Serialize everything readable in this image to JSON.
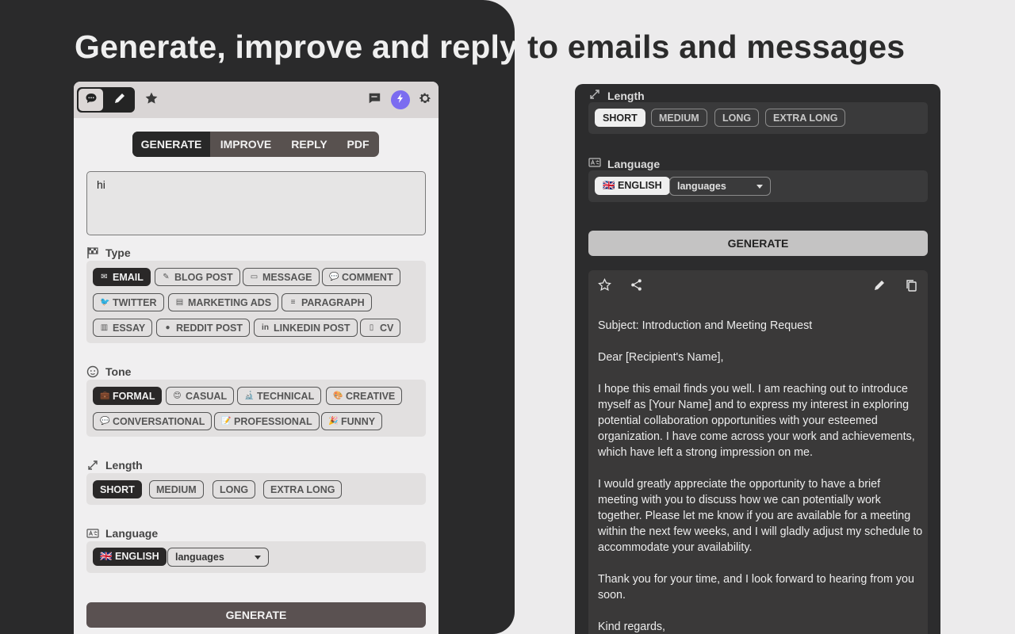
{
  "headline": {
    "part_a": "Generate, improve and reply",
    "part_b": "to emails and messages"
  },
  "colors": {
    "dark_bg": "#2a2a2b",
    "panel_light": "#f0eff0",
    "accent_purple": "#7b6cf0",
    "active_chip": "#2a2828"
  },
  "left_panel": {
    "toolbar": {
      "icons": [
        "chat-bubble-icon",
        "pencil-icon",
        "star-icon",
        "feedback-icon",
        "lightning-icon",
        "gear-icon"
      ]
    },
    "tabs": [
      {
        "label": "GENERATE",
        "active": true
      },
      {
        "label": "IMPROVE",
        "active": false
      },
      {
        "label": "REPLY",
        "active": false
      },
      {
        "label": "PDF",
        "active": false
      }
    ],
    "prompt_value": "hi",
    "type": {
      "label": "Type",
      "options": [
        {
          "label": "EMAIL",
          "icon": "✉",
          "active": true
        },
        {
          "label": "BLOG POST",
          "icon": "✎",
          "active": false
        },
        {
          "label": "MESSAGE",
          "icon": "▭",
          "active": false
        },
        {
          "label": "COMMENT",
          "icon": "💬",
          "active": false
        },
        {
          "label": "TWITTER",
          "icon": "🐦",
          "active": false
        },
        {
          "label": "MARKETING ADS",
          "icon": "▤",
          "active": false
        },
        {
          "label": "PARAGRAPH",
          "icon": "≡",
          "active": false
        },
        {
          "label": "ESSAY",
          "icon": "▥",
          "active": false
        },
        {
          "label": "REDDIT POST",
          "icon": "●",
          "active": false
        },
        {
          "label": "LINKEDIN POST",
          "icon": "in",
          "active": false
        },
        {
          "label": "CV",
          "icon": "▯",
          "active": false
        }
      ]
    },
    "tone": {
      "label": "Tone",
      "options": [
        {
          "label": "FORMAL",
          "icon": "💼",
          "active": true
        },
        {
          "label": "CASUAL",
          "icon": "😊",
          "active": false
        },
        {
          "label": "TECHNICAL",
          "icon": "🔬",
          "active": false
        },
        {
          "label": "CREATIVE",
          "icon": "🎨",
          "active": false
        },
        {
          "label": "CONVERSATIONAL",
          "icon": "💬",
          "active": false
        },
        {
          "label": "PROFESSIONAL",
          "icon": "📝",
          "active": false
        },
        {
          "label": "FUNNY",
          "icon": "🎉",
          "active": false
        }
      ]
    },
    "length": {
      "label": "Length",
      "options": [
        {
          "label": "SHORT",
          "active": true
        },
        {
          "label": "MEDIUM",
          "active": false
        },
        {
          "label": "LONG",
          "active": false
        },
        {
          "label": "EXTRA LONG",
          "active": false
        }
      ]
    },
    "language": {
      "label": "Language",
      "selected": "🇬🇧 ENGLISH",
      "dropdown": "languages"
    },
    "generate_label": "GENERATE"
  },
  "right_panel": {
    "length": {
      "label": "Length",
      "options": [
        {
          "label": "SHORT",
          "active": true
        },
        {
          "label": "MEDIUM",
          "active": false
        },
        {
          "label": "LONG",
          "active": false
        },
        {
          "label": "EXTRA LONG",
          "active": false
        }
      ]
    },
    "language": {
      "label": "Language",
      "selected": "🇬🇧 ENGLISH",
      "dropdown": "languages"
    },
    "generate_label": "GENERATE",
    "result": {
      "icons": [
        "star-icon",
        "share-icon",
        "pencil-icon",
        "copy-icon"
      ],
      "paragraphs": [
        "Subject: Introduction and Meeting Request",
        "Dear [Recipient's Name],",
        "I hope this email finds you well. I am reaching out to introduce myself as [Your Name] and to express my interest in exploring potential collaboration opportunities with your esteemed organization. I have come across your work and achievements, which have left a strong impression on me.",
        "I would greatly appreciate the opportunity to have a brief meeting with you to discuss how we can potentially work together. Please let me know if you are available for a meeting within the next few weeks, and I will gladly adjust my schedule to accommodate your availability.",
        "Thank you for your time, and I look forward to hearing from you soon.",
        "Kind regards,"
      ]
    }
  }
}
